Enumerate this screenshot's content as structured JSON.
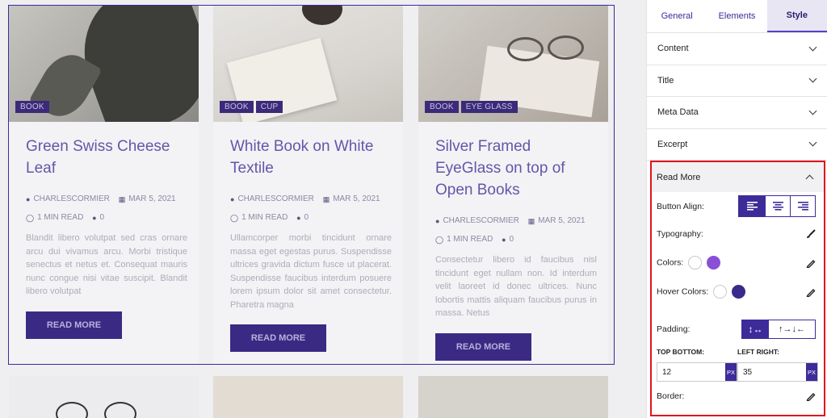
{
  "posts": [
    {
      "tags": [
        "BOOK"
      ],
      "title": "Green Swiss Cheese Leaf",
      "author": "CHARLESCORMIER",
      "date": "MAR 5, 2021",
      "read_time": "1 MIN READ",
      "comments": "0",
      "excerpt": "Blandit libero volutpat sed cras ornare arcu dui vivamus arcu. Morbi tristique senectus et netus et. Consequat mauris nunc congue nisi vitae suscipit. Blandit libero volutpat",
      "button": "READ MORE"
    },
    {
      "tags": [
        "BOOK",
        "CUP"
      ],
      "title": "White Book on White Textile",
      "author": "CHARLESCORMIER",
      "date": "MAR 5, 2021",
      "read_time": "1 MIN READ",
      "comments": "0",
      "excerpt": "Ullamcorper morbi tincidunt ornare massa eget egestas purus. Suspendisse ultrices gravida dictum fusce ut placerat. Suspendisse faucibus interdum posuere lorem ipsum dolor sit amet consectetur. Pharetra magna",
      "button": "READ MORE"
    },
    {
      "tags": [
        "BOOK",
        "EYE GLASS"
      ],
      "title": "Silver Framed EyeGlass on top of Open Books",
      "author": "CHARLESCORMIER",
      "date": "MAR 5, 2021",
      "read_time": "1 MIN READ",
      "comments": "0",
      "excerpt": "Consectetur libero id faucibus nisl tincidunt eget nullam non. Id interdum velit laoreet id donec ultrices. Nunc lobortis mattis aliquam faucibus purus in massa. Netus",
      "button": "READ MORE"
    }
  ],
  "panel": {
    "tabs": [
      "General",
      "Elements",
      "Style"
    ],
    "active_tab": "Style",
    "sections": [
      "Content",
      "Title",
      "Meta Data",
      "Excerpt"
    ],
    "read_more": {
      "title": "Read More",
      "button_align_label": "Button Align:",
      "typography_label": "Typography:",
      "colors_label": "Colors:",
      "hover_colors_label": "Hover Colors:",
      "padding_label": "Padding:",
      "top_bottom_label": "TOP BOTTOM:",
      "left_right_label": "LEFT RIGHT:",
      "top_bottom_value": "12",
      "left_right_value": "35",
      "unit": "PX",
      "border_label": "Border:",
      "padding_linked_glyph": "↕↔",
      "padding_separate_glyph": "↑→↓←"
    },
    "colors": {
      "accent": "#3d2b9a",
      "swatch_purple": "#8a4fd6",
      "swatch_dark": "#3a2a8c",
      "highlight": "#e0141d"
    }
  }
}
